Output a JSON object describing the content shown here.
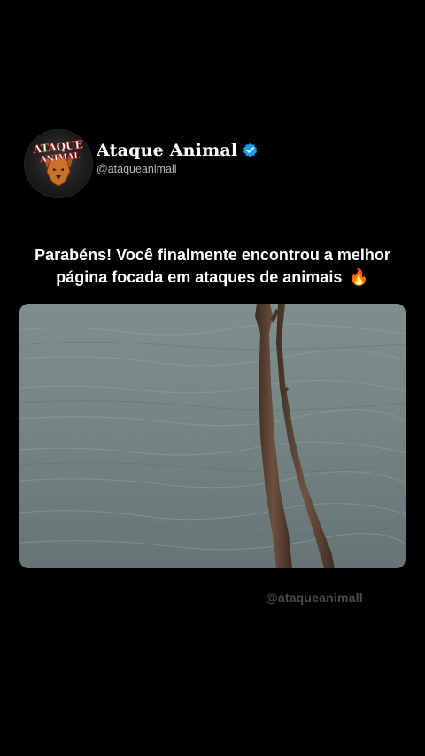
{
  "profile": {
    "display_name": "Ataque Animal",
    "handle": "@ataqueanimall",
    "verified": true,
    "avatar_logo_text_line1": "ATAQUE",
    "avatar_logo_text_line2": "ANIMAL"
  },
  "post": {
    "caption_line1": "Parabéns! Você finalmente encontrou a melhor",
    "caption_line2": "página focada em ataques de animais",
    "caption_emoji": "🔥"
  },
  "video": {
    "icon": "river-with-branches-image"
  },
  "watermark": {
    "text": "@ataqueanimall"
  },
  "colors": {
    "background": "#000000",
    "verified_badge": "#1d9bf0",
    "water": "#788887",
    "watermark": "#4a4a4a"
  }
}
